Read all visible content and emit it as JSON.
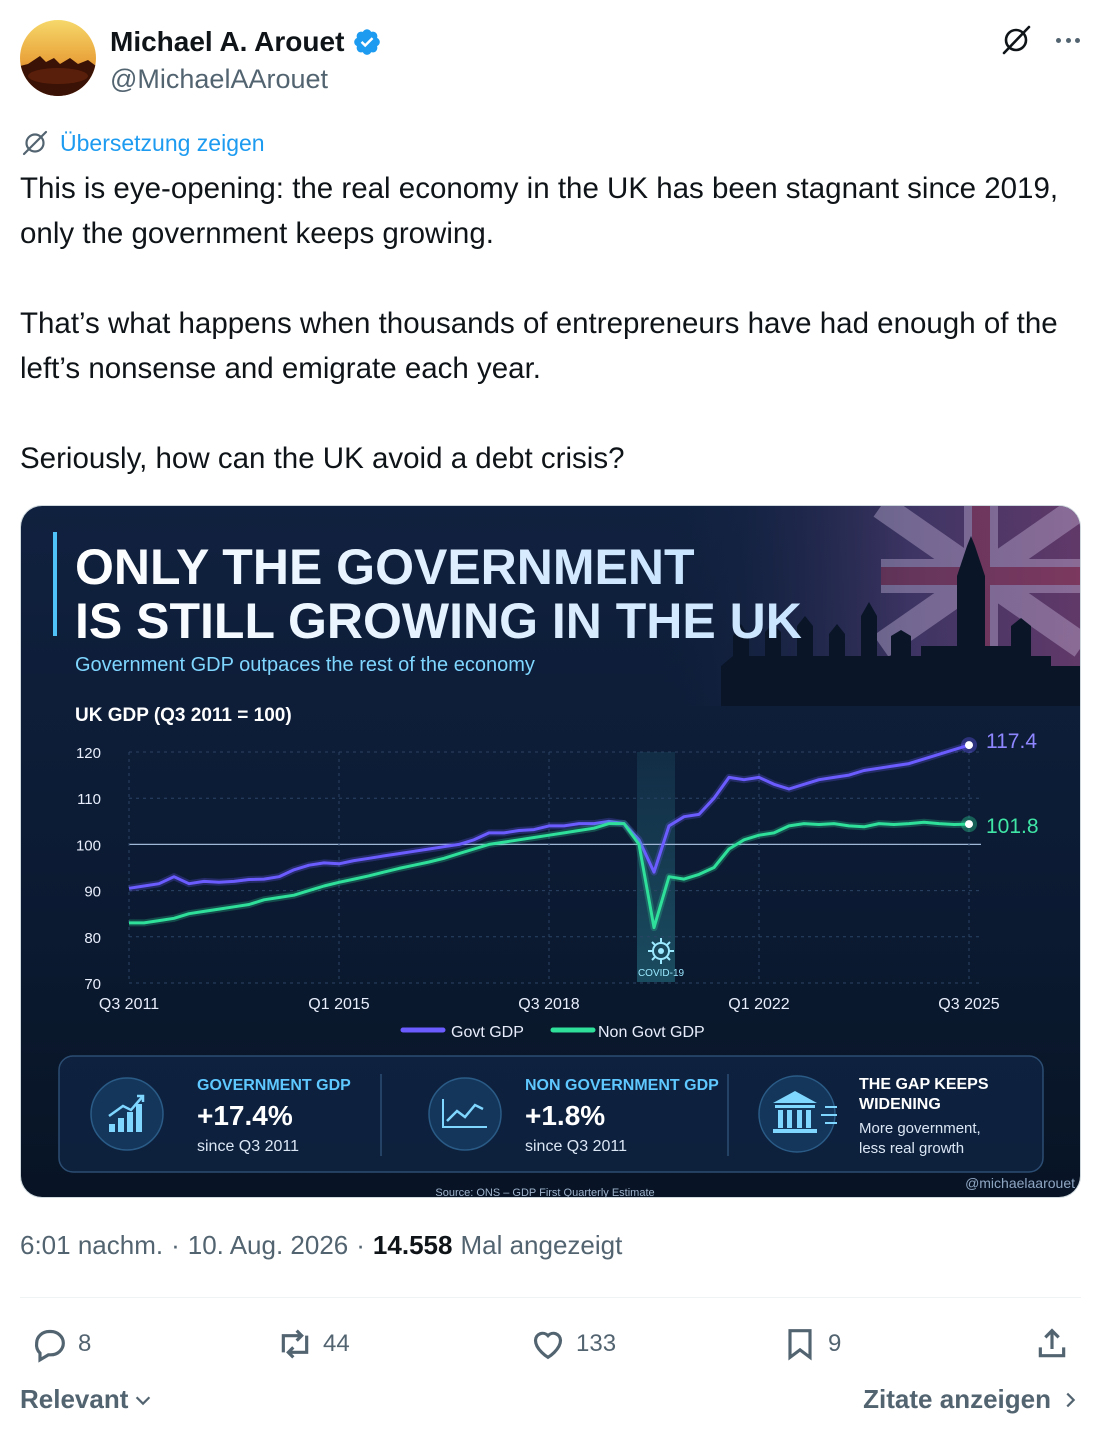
{
  "author": {
    "name": "Michael A. Arouet",
    "handle": "@MichaelAArouet",
    "verified": true
  },
  "translate": {
    "label": "Übersetzung zeigen"
  },
  "tweet": {
    "paragraphs": [
      "This is eye-opening: the real economy in the UK has been stagnant since 2019, only the government keeps growing.",
      "That’s what happens when thousands of entrepreneurs have had enough of the left’s nonsense and emigrate each year.",
      "Seriously, how can the UK avoid a debt crisis?"
    ]
  },
  "infographic": {
    "title_line1": "ONLY THE GOVERNMENT",
    "title_line2": "IS STILL GROWING IN THE UK",
    "subtitle": "Government GDP outpaces the rest of the economy",
    "covid_label": "COVID-19",
    "end_label_govt": "117.4",
    "end_label_nongovt": "101.8",
    "stats": [
      {
        "title": "GOVERNMENT GDP",
        "value": "+17.4%",
        "note": "since Q3 2011",
        "icon": "bar-chart-up-icon"
      },
      {
        "title": "NON GOVERNMENT GDP",
        "value": "+1.8%",
        "note": "since Q3 2011",
        "icon": "line-chart-icon"
      },
      {
        "title_line1": "THE GAP KEEPS",
        "title_line2": "WIDENING",
        "note_line1": "More government,",
        "note_line2": "less real growth",
        "icon": "government-building-icon"
      }
    ],
    "source": "Source: ONS – GDP First Quarterly Estimate",
    "watermark": "@michaelaarouet"
  },
  "chart_data": {
    "type": "line",
    "title": "UK GDP (Q3 2011 = 100)",
    "ylim": [
      70,
      120
    ],
    "yticks": [
      70,
      80,
      90,
      100,
      110,
      120
    ],
    "xticks": [
      "Q3 2011",
      "Q1 2015",
      "Q3 2018",
      "Q1 2022",
      "Q3 2025"
    ],
    "xtick_index": [
      0,
      14,
      28,
      42,
      56
    ],
    "grid": true,
    "legend": "bottom",
    "series": [
      {
        "name": "Govt GDP",
        "color": "#6b5cff",
        "values": [
          90.5,
          91,
          91.5,
          93,
          91.5,
          92,
          91.8,
          92,
          92.4,
          92.5,
          93,
          94.5,
          95.5,
          96,
          95.8,
          96.5,
          97,
          97.5,
          98,
          98.5,
          99,
          99.5,
          100,
          101,
          102.5,
          102.5,
          103,
          103.2,
          104,
          104,
          104.5,
          104.5,
          105,
          104.5,
          101,
          94,
          104,
          106,
          106.5,
          110,
          114.5,
          114,
          114.5,
          113,
          112,
          113,
          114,
          114.5,
          115,
          116,
          116.5,
          117,
          117.5,
          118.5,
          119.5,
          120.5,
          121.5
        ]
      },
      {
        "name": "Non Govt GDP",
        "color": "#2fe09a",
        "values": [
          83,
          83,
          83.5,
          84,
          85,
          85.5,
          86,
          86.5,
          87,
          88,
          88.5,
          89,
          90,
          91,
          91.8,
          92.5,
          93.2,
          94,
          94.8,
          95.5,
          96.2,
          97,
          98,
          99,
          100,
          100.5,
          101,
          101.5,
          102,
          102.5,
          103,
          103.5,
          104.5,
          104.5,
          100,
          82,
          93,
          92.5,
          93.5,
          95,
          99,
          101,
          102,
          102.5,
          104,
          104.5,
          104.3,
          104.5,
          104,
          103.8,
          104.5,
          104.3,
          104.5,
          104.8,
          104.5,
          104.3,
          104.4
        ]
      }
    ]
  },
  "timestamp": {
    "time": "6:01 nachm.",
    "date": "10. Aug. 2026",
    "views": "14.558",
    "views_label": "Mal angezeigt"
  },
  "actions": {
    "replies": "8",
    "reposts": "44",
    "likes": "133",
    "bookmarks": "9"
  },
  "footer": {
    "sort_label": "Relevant",
    "quotes_label": "Zitate anzeigen"
  },
  "colors": {
    "link": "#1d9bf0",
    "muted": "#536471",
    "verified": "#1d9bf0",
    "infographic_bg": "#0d1b33"
  }
}
